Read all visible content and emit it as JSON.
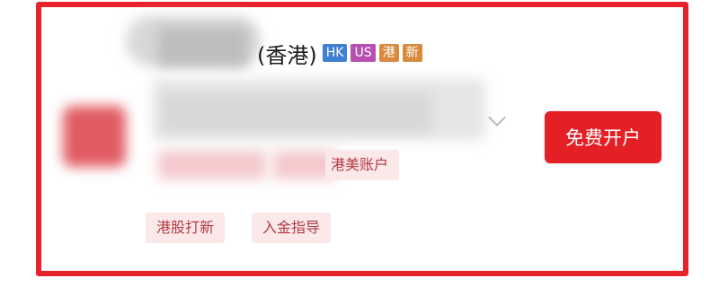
{
  "broker": {
    "name_suffix": "(香港)",
    "badges": [
      {
        "label": "HK",
        "color": "#3f7fd1"
      },
      {
        "label": "US",
        "color": "#b64fb0"
      },
      {
        "label": "港",
        "color": "#d88a3f"
      },
      {
        "label": "新",
        "color": "#d88a3f"
      }
    ]
  },
  "actions": {
    "open_account": "免费开户"
  },
  "tags": {
    "hk_us_account": "港美账户",
    "ipo": "港股打新",
    "deposit_guide": "入金指导"
  },
  "colors": {
    "frame": "#e8222b",
    "button": "#e41f26",
    "tag_bg": "#fbe9ea",
    "tag_text": "#b23a42"
  }
}
